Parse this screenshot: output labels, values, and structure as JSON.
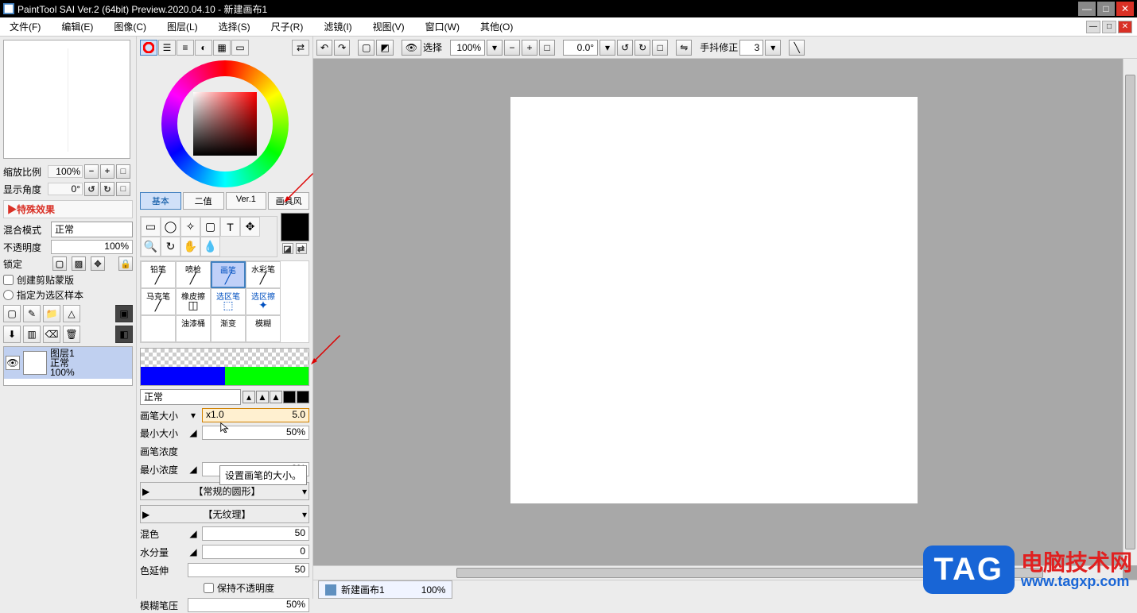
{
  "title": "PaintTool SAI Ver.2 (64bit) Preview.2020.04.10 - 新建画布1",
  "menu": [
    "文件(F)",
    "编辑(E)",
    "图像(C)",
    "图层(L)",
    "选择(S)",
    "尺子(R)",
    "滤镜(I)",
    "视图(V)",
    "窗口(W)",
    "其他(O)"
  ],
  "nav": {
    "zoom_label": "缩放比例",
    "zoom_val": "100%",
    "angle_label": "显示角度",
    "angle_val": "0°"
  },
  "effects": "▶特殊效果",
  "blend": {
    "label": "混合模式",
    "mode": "正常"
  },
  "opacity": {
    "label": "不透明度",
    "val": "100%"
  },
  "lock": {
    "label": "锁定"
  },
  "clipmask": "创建剪贴蒙版",
  "seltemplate": "指定为选区样本",
  "layer": {
    "name": "图层1",
    "mode": "正常",
    "pct": "100%"
  },
  "tooltabs": [
    "基本",
    "二值",
    "Ver.1",
    "画具风"
  ],
  "brushes": [
    "铅笔",
    "喷枪",
    "画笔",
    "水彩笔",
    "马克笔",
    "橡皮擦",
    "选区笔",
    "选区擦",
    "",
    "油漆桶",
    "渐变",
    "模糊"
  ],
  "brush_mode": "正常",
  "params": {
    "size_label": "画笔大小",
    "size_min": "x1.0",
    "size_val": "5.0",
    "minsize_label": "最小大小",
    "minsize_val": "50%",
    "density_label": "画笔浓度",
    "mindensity_label": "最小浓度",
    "mindensity_val": "0%",
    "shape": "【常规的圆形】",
    "texture": "【无纹理】",
    "blend_label": "混色",
    "blend_val": "50",
    "water_label": "水分量",
    "water_val": "0",
    "spread_label": "色延伸",
    "spread_val": "50",
    "keepalpha": "保持不透明度",
    "blur_label": "模糊笔压",
    "blur_val": "50%"
  },
  "tooltip": "设置画笔的大小。",
  "topbar": {
    "select": "选择",
    "zoom": "100%",
    "angle": "0.0°",
    "stab_label": "手抖修正",
    "stab_val": "3"
  },
  "bottom": {
    "doc": "新建画布1",
    "pct": "100%"
  },
  "watermark": {
    "tag": "TAG",
    "cn": "电脑技术网",
    "url": "www.tagxp.com"
  }
}
